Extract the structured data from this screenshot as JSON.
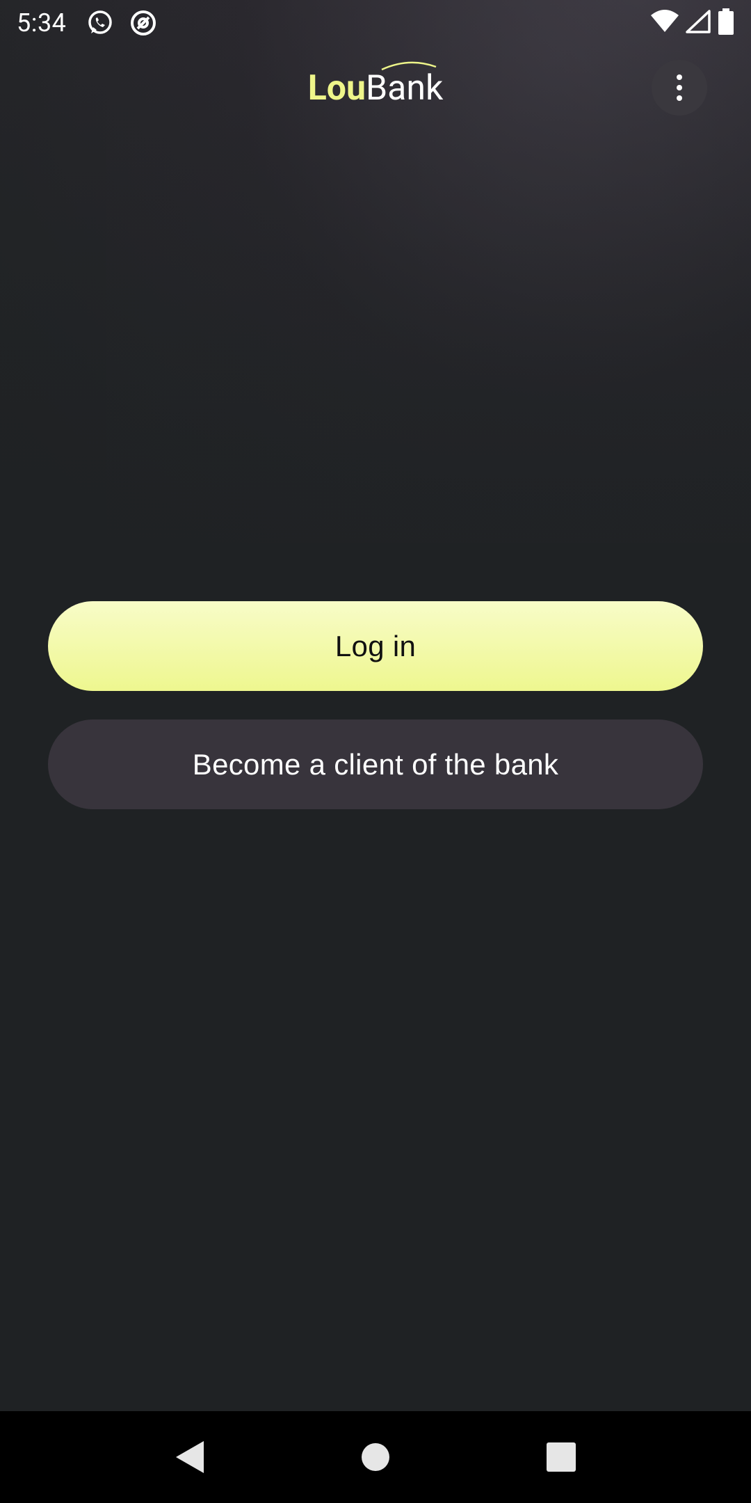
{
  "status_bar": {
    "time": "5:34",
    "icons_left": [
      "whatsapp-icon",
      "at-sign-icon"
    ],
    "icons_right": [
      "wifi-icon",
      "cell-signal-icon",
      "battery-icon"
    ]
  },
  "header": {
    "logo_part1": "Lou",
    "logo_part2": "Bank",
    "menu_icon": "more-vertical-icon"
  },
  "actions": {
    "login_label": "Log in",
    "register_label": "Become a client of the bank"
  },
  "nav_bar": {
    "items": [
      "back-icon",
      "home-icon",
      "recents-icon"
    ]
  },
  "colors": {
    "background": "#1f2224",
    "accent": "#eef58a",
    "login_button": "#f2f9a8",
    "secondary_button": "#38343c",
    "nav_bar": "#000000"
  }
}
